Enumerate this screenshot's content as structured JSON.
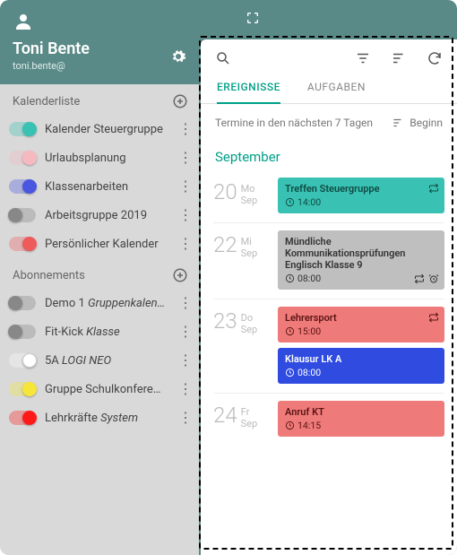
{
  "user": {
    "name": "Toni Bente",
    "email": "toni.bente@"
  },
  "sidebar": {
    "section_calendar": "Kalenderliste",
    "section_subs": "Abonnements",
    "calendars": [
      {
        "label": "Kalender Steuergruppe",
        "color": "#39c2b3",
        "on": true
      },
      {
        "label": "Urlaubsplanung",
        "color": "#f7b9c0",
        "on": true
      },
      {
        "label": "Klassenarbeiten",
        "color": "#4a56e0",
        "on": true
      },
      {
        "label": "Arbeitsgruppe 2019",
        "color": "#888888",
        "on": false
      },
      {
        "label": "Persönlicher Kalender",
        "color": "#ef5a5a",
        "on": true
      }
    ],
    "subs": [
      {
        "label": "Demo 1 ",
        "em": "Gruppenkalen…",
        "color": "#888888",
        "on": false
      },
      {
        "label": "Fit-Kick ",
        "em": "Klasse",
        "color": "#888888",
        "on": false
      },
      {
        "label": "5A ",
        "em": "LOGI NEO",
        "color": "#ffffff",
        "on": true
      },
      {
        "label": "Gruppe Schulkonfere…",
        "em": "",
        "color": "#f6e63a",
        "on": true
      },
      {
        "label": "Lehrkräfte ",
        "em": "System",
        "color": "#ff1a1a",
        "on": true
      }
    ]
  },
  "panel": {
    "tabs": {
      "events": "EREIGNISSE",
      "tasks": "AUFGABEN"
    },
    "subhead_text": "Termine in den nächsten 7 Tagen",
    "subhead_right": "Beginn",
    "month": "September",
    "days": [
      {
        "num": "20",
        "dow": "Mo",
        "mon": "Sep",
        "events": [
          {
            "title": "Treffen Steuergruppe",
            "time": "14:00",
            "bg": "#39c2b3",
            "fg": "#104a43",
            "repeat": true,
            "alarm": false
          }
        ]
      },
      {
        "num": "22",
        "dow": "Mi",
        "mon": "Sep",
        "events": [
          {
            "title": "Mündliche Kommunikationsprüfungen Englisch Klasse 9",
            "time": "08:00",
            "bg": "#bfbfbf",
            "fg": "#333333",
            "repeat": true,
            "alarm": true
          }
        ]
      },
      {
        "num": "23",
        "dow": "Do",
        "mon": "Sep",
        "events": [
          {
            "title": "Lehrersport",
            "time": "15:00",
            "bg": "#ef7a7a",
            "fg": "#5a1414",
            "repeat": true,
            "alarm": false
          },
          {
            "title": "Klausur LK A",
            "time": "08:00",
            "bg": "#2f4be0",
            "fg": "#ffffff",
            "repeat": false,
            "alarm": false
          }
        ]
      },
      {
        "num": "24",
        "dow": "Fr",
        "mon": "Sep",
        "events": [
          {
            "title": "Anruf KT",
            "time": "14:15",
            "bg": "#ef7a7a",
            "fg": "#5a1414",
            "repeat": false,
            "alarm": false
          }
        ]
      }
    ]
  }
}
